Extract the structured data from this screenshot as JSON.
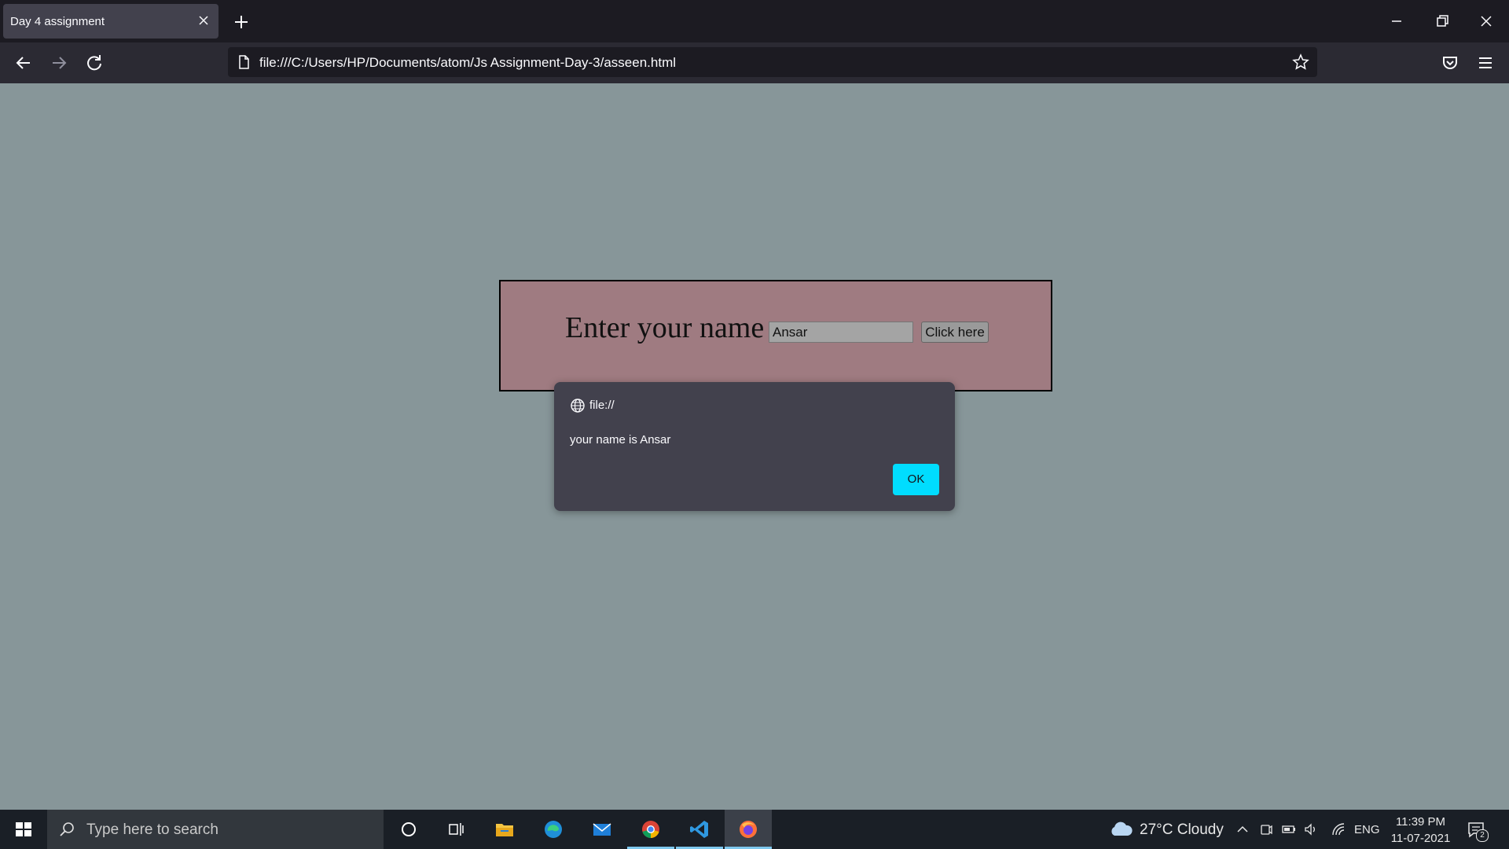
{
  "browser": {
    "tab_title": "Day 4 assignment",
    "url": "file:///C:/Users/HP/Documents/atom/Js Assignment-Day-3/asseen.html"
  },
  "page": {
    "label": "Enter your name",
    "input_value": "Ansar",
    "button_label": "Click here",
    "background_color": "#879699",
    "card_color": "#9f7b81"
  },
  "dialog": {
    "origin": "file://",
    "message": "your name is Ansar",
    "ok_label": "OK",
    "ok_color": "#00ddff"
  },
  "taskbar": {
    "search_placeholder": "Type here to search",
    "apps": [
      "cortana-icon",
      "task-view-icon",
      "file-explorer-icon",
      "edge-icon",
      "mail-icon",
      "chrome-icon",
      "vscode-icon",
      "firefox-icon"
    ],
    "weather": "27°C  Cloudy",
    "language": "ENG",
    "time": "11:39 PM",
    "date": "11-07-2021",
    "notification_count": "2"
  }
}
